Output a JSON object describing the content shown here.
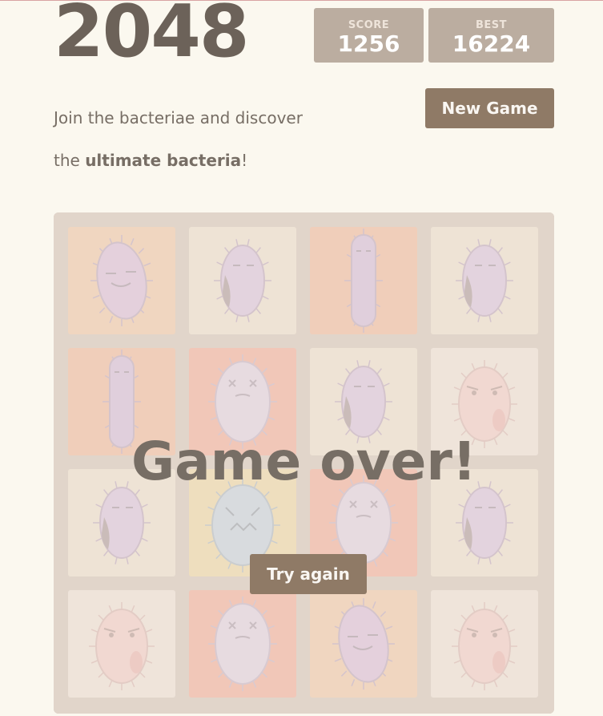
{
  "header": {
    "title": "2048",
    "score_label": "SCORE",
    "score_value": "1256",
    "best_label": "BEST",
    "best_value": "16224"
  },
  "intro": {
    "line1": "Join the bacteriae and discover",
    "line2_prefix": "the ",
    "line2_bold": "ultimate bacteria",
    "line2_suffix": "!"
  },
  "buttons": {
    "new_game": "New Game",
    "try_again": "Try again"
  },
  "overlay": {
    "message": "Game over!"
  },
  "colors": {
    "board": "#bbada0",
    "button": "#8f7a66",
    "background": "#fbf8ef"
  },
  "board": {
    "tiles": [
      {
        "bg": "#f2b179",
        "germ": "purple-bean-smile"
      },
      {
        "bg": "#ede0c8",
        "germ": "purple-tongue"
      },
      {
        "bg": "#f59563",
        "germ": "purple-rod"
      },
      {
        "bg": "#ede0c8",
        "germ": "purple-tongue"
      },
      {
        "bg": "#f59563",
        "germ": "purple-rod"
      },
      {
        "bg": "#f67c5f",
        "germ": "lavender-dizzy"
      },
      {
        "bg": "#ede0c8",
        "germ": "purple-tongue"
      },
      {
        "bg": "#eee4da",
        "germ": "pink-angry"
      },
      {
        "bg": "#ede0c8",
        "germ": "purple-tongue"
      },
      {
        "bg": "#edcf72",
        "germ": "blue-scared"
      },
      {
        "bg": "#f67c5f",
        "germ": "lavender-dizzy"
      },
      {
        "bg": "#ede0c8",
        "germ": "purple-tongue"
      },
      {
        "bg": "#eee4da",
        "germ": "pink-angry"
      },
      {
        "bg": "#f67c5f",
        "germ": "lavender-dizzy"
      },
      {
        "bg": "#f2b179",
        "germ": "purple-bean-smile"
      },
      {
        "bg": "#eee4da",
        "germ": "pink-angry"
      }
    ]
  }
}
